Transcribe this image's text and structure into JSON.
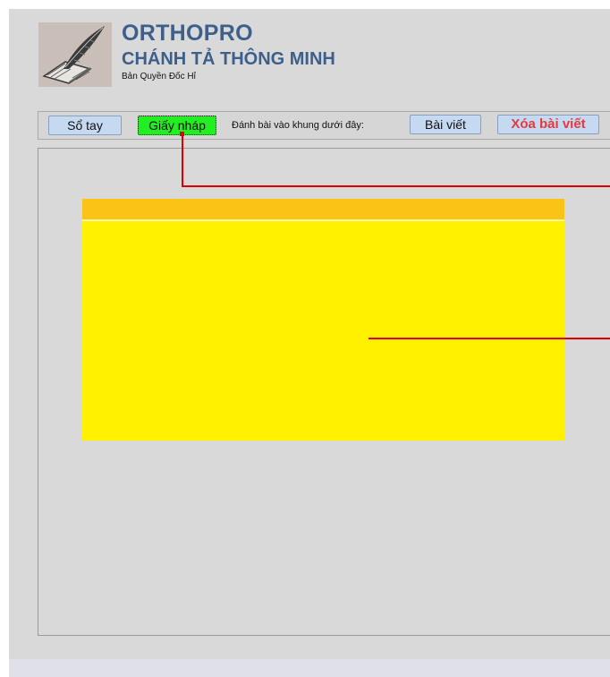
{
  "header": {
    "title": "ORTHOPRO",
    "subtitle": "CHÁNH TẢ THÔNG MINH",
    "copyright": "Bản Quyền Đốc Hỉ",
    "logo_icon": "book-quill-icon"
  },
  "toolbar": {
    "notebook_label": "Sổ tay",
    "draft_label": "Giấy nháp",
    "hint_text": "Đánh bài vào khung dưới đây:",
    "article_label": "Bài viết",
    "delete_label": "Xóa bài viết"
  },
  "colors": {
    "accent_title": "#3d5f8a",
    "draft_active": "#22ee22",
    "delete_text": "#e8383c",
    "note_header": "#fbc316",
    "note_body": "#fff100",
    "callout": "#e00000"
  }
}
